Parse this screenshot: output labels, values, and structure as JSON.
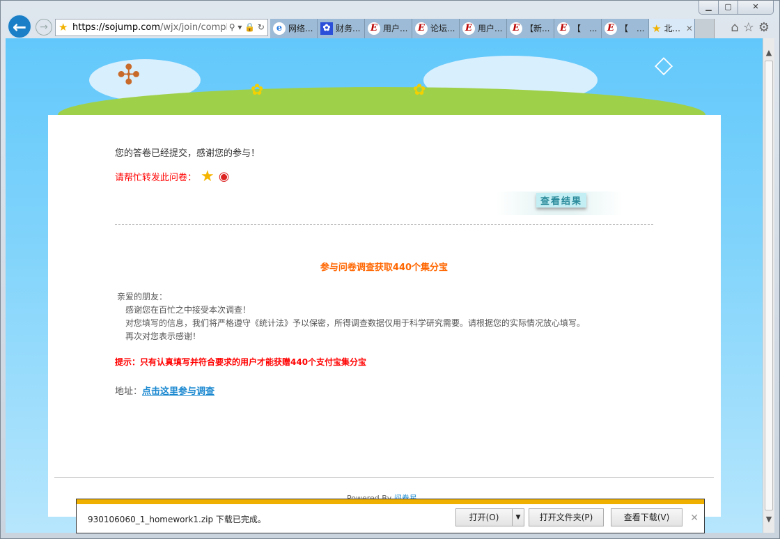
{
  "browser": {
    "url_host": "https://sojump.com",
    "url_path": "/wjx/join/comple",
    "tabs": [
      {
        "label": "网络...",
        "icon": "ie-icon"
      },
      {
        "label": "财务...",
        "icon": "baidu-paw-icon"
      },
      {
        "label": "用户...",
        "icon": "e-icon"
      },
      {
        "label": "论坛...",
        "icon": "e-icon"
      },
      {
        "label": "用户...",
        "icon": "e-icon"
      },
      {
        "label": "【新...",
        "icon": "e-icon"
      },
      {
        "label": "【　...",
        "icon": "e-icon"
      },
      {
        "label": "【　...",
        "icon": "e-icon"
      },
      {
        "label": "北...",
        "icon": "star-icon",
        "active": true
      }
    ]
  },
  "page": {
    "submitted": "您的答卷已经提交，感谢您的参与！",
    "share_label": "请帮忙转发此问卷：",
    "view_results": "查看结果",
    "headline": "参与问卷调查获取440个集分宝",
    "greeting": "亲爱的朋友：",
    "lines": [
      "感谢您在百忙之中接受本次调查！",
      "对您填写的信息，我们将严格遵守《统计法》予以保密，所得调查数据仅用于科学研究需要。请根据您的实际情况放心填写。",
      "再次对您表示感谢！"
    ],
    "tip": "提示：只有认真填写并符合要求的用户才能获赠440个支付宝集分宝",
    "address_label": "地址：",
    "address_link": "点击这里参与调查",
    "powered_by": "Powered By",
    "powered_brand": "问卷星"
  },
  "download": {
    "filename": "930106060_1_homework1.zip 下载已完成。",
    "open": "打开(O)",
    "open_folder": "打开文件夹(P)",
    "view_downloads": "查看下载(V)"
  },
  "colors": {
    "accent": "#f0b000",
    "link": "#1a88d0",
    "headline": "#ff6600",
    "alert": "#ff0000"
  }
}
